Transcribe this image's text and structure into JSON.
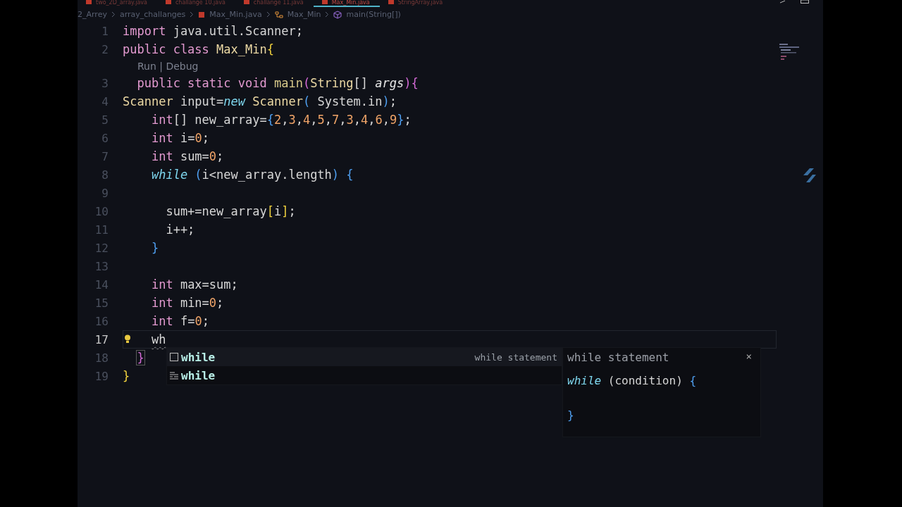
{
  "tabs": [
    {
      "label": "two_2D_array.java",
      "selected": false
    },
    {
      "label": "challange 10.java",
      "selected": false
    },
    {
      "label": "challange 11.java",
      "selected": false
    },
    {
      "label": "Max_Min.java",
      "selected": true
    },
    {
      "label": "StringArray.java",
      "selected": false
    }
  ],
  "breadcrumb": [
    {
      "label": "2_Arrey",
      "kind": "folder"
    },
    {
      "label": "array_challanges",
      "kind": "folder"
    },
    {
      "label": "Max_Min.java",
      "kind": "file"
    },
    {
      "label": "Max_Min",
      "kind": "class"
    },
    {
      "label": "main(String[])",
      "kind": "method"
    }
  ],
  "lines": [
    {
      "number": "1",
      "current": false,
      "lightbulb": false,
      "tokens": [
        {
          "t": "import",
          "kind": "kw"
        },
        {
          "t": " java.util.Scanner;",
          "kind": "plain"
        }
      ]
    },
    {
      "number": "2",
      "current": false,
      "lightbulb": false,
      "tokens": [
        {
          "t": "public class",
          "kind": "kw"
        },
        {
          "t": " Max_Min",
          "kind": "type"
        },
        {
          "t": "{",
          "kind": "b1"
        }
      ],
      "codelens": "Run | Debug"
    },
    {
      "number": "3",
      "current": false,
      "lightbulb": false,
      "tokens": [
        {
          "t": "  public static void",
          "kind": "kw"
        },
        {
          "t": " main",
          "kind": "fn"
        },
        {
          "t": "(",
          "kind": "b2"
        },
        {
          "t": "String",
          "kind": "type"
        },
        {
          "t": "[] ",
          "kind": "plain"
        },
        {
          "t": "args",
          "kind": "param"
        },
        {
          "t": ")",
          "kind": "b2"
        },
        {
          "t": "{",
          "kind": "b2"
        }
      ]
    },
    {
      "number": "4",
      "current": false,
      "lightbulb": false,
      "tokens": [
        {
          "t": "Scanner",
          "kind": "type"
        },
        {
          "t": " input=",
          "kind": "plain"
        },
        {
          "t": "new",
          "kind": "ital"
        },
        {
          "t": " Scanner",
          "kind": "type"
        },
        {
          "t": "(",
          "kind": "b3"
        },
        {
          "t": " System.in",
          "kind": "plain"
        },
        {
          "t": ")",
          "kind": "b3"
        },
        {
          "t": ";",
          "kind": "plain"
        }
      ]
    },
    {
      "number": "5",
      "current": false,
      "lightbulb": false,
      "tokens": [
        {
          "t": "    int",
          "kind": "kw"
        },
        {
          "t": "[] new_array=",
          "kind": "plain"
        },
        {
          "t": "{",
          "kind": "b3"
        },
        {
          "t": "2",
          "kind": "num"
        },
        {
          "t": ",",
          "kind": "plain"
        },
        {
          "t": "3",
          "kind": "num"
        },
        {
          "t": ",",
          "kind": "plain"
        },
        {
          "t": "4",
          "kind": "num"
        },
        {
          "t": ",",
          "kind": "plain"
        },
        {
          "t": "5",
          "kind": "num"
        },
        {
          "t": ",",
          "kind": "plain"
        },
        {
          "t": "7",
          "kind": "num"
        },
        {
          "t": ",",
          "kind": "plain"
        },
        {
          "t": "3",
          "kind": "num"
        },
        {
          "t": ",",
          "kind": "plain"
        },
        {
          "t": "4",
          "kind": "num"
        },
        {
          "t": ",",
          "kind": "plain"
        },
        {
          "t": "6",
          "kind": "num"
        },
        {
          "t": ",",
          "kind": "plain"
        },
        {
          "t": "9",
          "kind": "num"
        },
        {
          "t": "}",
          "kind": "b3"
        },
        {
          "t": ";",
          "kind": "plain"
        }
      ]
    },
    {
      "number": "6",
      "current": false,
      "lightbulb": false,
      "tokens": [
        {
          "t": "    int",
          "kind": "kw"
        },
        {
          "t": " i=",
          "kind": "plain"
        },
        {
          "t": "0",
          "kind": "num"
        },
        {
          "t": ";",
          "kind": "plain"
        }
      ]
    },
    {
      "number": "7",
      "current": false,
      "lightbulb": false,
      "tokens": [
        {
          "t": "    int",
          "kind": "kw"
        },
        {
          "t": " sum=",
          "kind": "plain"
        },
        {
          "t": "0",
          "kind": "num"
        },
        {
          "t": ";",
          "kind": "plain"
        }
      ]
    },
    {
      "number": "8",
      "current": false,
      "lightbulb": false,
      "tokens": [
        {
          "t": "    while",
          "kind": "ital"
        },
        {
          "t": " (",
          "kind": "b3"
        },
        {
          "t": "i<new_array.length",
          "kind": "plain"
        },
        {
          "t": ") {",
          "kind": "b3"
        }
      ]
    },
    {
      "number": "9",
      "current": false,
      "lightbulb": false
    },
    {
      "number": "10",
      "current": false,
      "lightbulb": false,
      "tokens": [
        {
          "t": "      sum+=new_array",
          "kind": "plain"
        },
        {
          "t": "[",
          "kind": "b1"
        },
        {
          "t": "i",
          "kind": "plain"
        },
        {
          "t": "]",
          "kind": "b1"
        },
        {
          "t": ";",
          "kind": "plain"
        }
      ]
    },
    {
      "number": "11",
      "current": false,
      "lightbulb": false,
      "tokens": [
        {
          "t": "      i++;",
          "kind": "plain"
        }
      ]
    },
    {
      "number": "12",
      "current": false,
      "lightbulb": false,
      "tokens": [
        {
          "t": "    }",
          "kind": "b3"
        }
      ]
    },
    {
      "number": "13",
      "current": false,
      "lightbulb": false
    },
    {
      "number": "14",
      "current": false,
      "lightbulb": false,
      "tokens": [
        {
          "t": "    int",
          "kind": "kw"
        },
        {
          "t": " max=sum;",
          "kind": "plain"
        }
      ]
    },
    {
      "number": "15",
      "current": false,
      "lightbulb": false,
      "tokens": [
        {
          "t": "    int",
          "kind": "kw"
        },
        {
          "t": " min=",
          "kind": "plain"
        },
        {
          "t": "0",
          "kind": "num"
        },
        {
          "t": ";",
          "kind": "plain"
        }
      ]
    },
    {
      "number": "16",
      "current": false,
      "lightbulb": false,
      "tokens": [
        {
          "t": "    int",
          "kind": "kw"
        },
        {
          "t": " f=",
          "kind": "plain"
        },
        {
          "t": "0",
          "kind": "num"
        },
        {
          "t": ";",
          "kind": "plain"
        }
      ]
    },
    {
      "number": "17",
      "current": true,
      "lightbulb": true,
      "tokens": [
        {
          "t": "    wh",
          "kind": "squiggle"
        }
      ]
    },
    {
      "number": "18",
      "current": false,
      "lightbulb": false,
      "tokens": [
        {
          "t": "  }",
          "kind": "b2m"
        }
      ]
    },
    {
      "number": "19",
      "current": false,
      "lightbulb": false,
      "tokens": [
        {
          "t": "}",
          "kind": "b1"
        }
      ]
    }
  ],
  "suggestions": [
    {
      "kind": "snippet",
      "label": "while",
      "detail": "while statement",
      "selected": true
    },
    {
      "kind": "keyword",
      "label": "while",
      "selected": false
    }
  ],
  "details": {
    "title": "while statement",
    "close": "×",
    "code": [
      [
        {
          "t": "while",
          "kind": "ital"
        },
        {
          "t": " (condition) ",
          "kind": "plain"
        },
        {
          "t": "{",
          "kind": "b3"
        }
      ],
      [
        {
          "t": "}",
          "kind": "b3"
        }
      ]
    ]
  }
}
